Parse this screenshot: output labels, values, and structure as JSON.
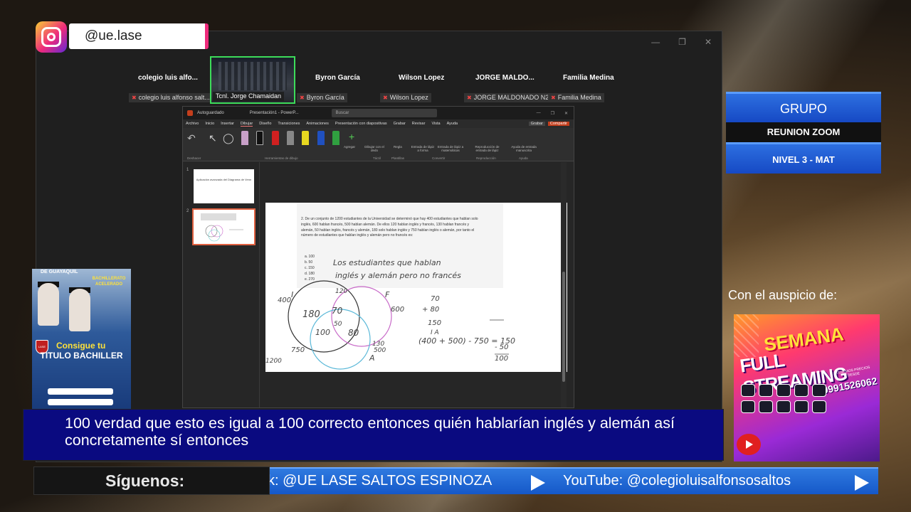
{
  "overlay": {
    "instagram_handle": "@ue.lase",
    "grupo": {
      "row1": "GRUPO",
      "row2": "REUNION ZOOM",
      "row3": "NIVEL 3 - MAT"
    },
    "auspicio": "Con el auspicio de:",
    "siguenos": "Síguenos:",
    "ticker": [
      "k: @UE LASE SALTOS ESPINOZA",
      "YouTube: @colegioluisalfonsosaltos"
    ],
    "caption": "100 verdad que esto es igual a 100 correcto entonces quién hablarían inglés y alemán así concretamente sí entonces"
  },
  "zoom": {
    "participants": [
      {
        "name": "colegio luis alfo...",
        "tag": "colegio luis alfonso salt..."
      },
      {
        "name": "",
        "tag": "Tcnl. Jorge Chamaidan"
      },
      {
        "name": "Byron García",
        "tag": "Byron García"
      },
      {
        "name": "Wilson Lopez",
        "tag": "Wilson Lopez"
      },
      {
        "name": "JORGE MALDO...",
        "tag": "JORGE MALDONADO N2"
      },
      {
        "name": "Familia Medina",
        "tag": "Familia Medina"
      }
    ]
  },
  "powerpoint": {
    "autosave": "Autoguardado",
    "file": "Presentación1 - PowerP...",
    "search_placeholder": "Buscar",
    "menu": [
      "Archivo",
      "Inicio",
      "Insertar",
      "Dibujar",
      "Diseño",
      "Transiciones",
      "Animaciones",
      "Presentación con diapositivas",
      "Grabar",
      "Revisar",
      "Vista",
      "Ayuda"
    ],
    "active_menu": "Dibujar",
    "grabar": "Grabar",
    "share": "Compartir",
    "ribbon_labels": [
      "Agregar",
      "Dibujar con el dedo",
      "Regla",
      "Entrada de lápiz a forma",
      "Entrada de lápiz a matemáticas",
      "Reproducción de entrada de lápiz",
      "Ayuda de entrada manuscrita"
    ],
    "ribbon_groups": [
      "Deshacer",
      "Herramientas de dibujo",
      "Táctil",
      "Plantillas",
      "Convertir",
      "Reproducción",
      "Ayuda"
    ],
    "thumb1_title": "Aplicación avanzada del Diagrama de Venn",
    "slide": {
      "problem": "2. De un conjunto de 1200 estudiantes de la Universidad se determinó que hay 400 estudiantes que hablan solo inglés, 600 hablan francés, 500 hablan alemán. De ellos 120 hablan inglés y francés, 130 hablan francés y alemán, 50 hablan inglés, francés y alemán, 180 solo hablan inglés y 750 hablan inglés o alemán, por tanto el número de estudiantes que hablan inglés y alemán pero no francés es:",
      "options": [
        "a. 100",
        "b. 50",
        "c. 150",
        "d. 180",
        "e. 270"
      ],
      "handwriting1": "Los estudiantes que hablan",
      "handwriting2": "inglés y alemán pero no francés",
      "venn_labels": [
        "I",
        "F",
        "A"
      ],
      "venn_values": [
        "400",
        "120",
        "180",
        "70",
        "600",
        "100",
        "50",
        "80",
        "750",
        "130",
        "500",
        "1200"
      ],
      "calc": [
        "70",
        "+ 80",
        "150",
        "I      A",
        "(400 + 500) - 750 = 150",
        "- 50",
        "100"
      ]
    }
  },
  "promo": {
    "title1": "SEMANA",
    "title2": "FULL STREAMING",
    "price": "TENEMOS PRECIOS DESDE",
    "phone": "0991526062"
  },
  "bachiller": {
    "top": "DE GUAYAQUIL",
    "badge": "BACHILLERATO ACELERADO",
    "headline": "Consigue tu",
    "title": "TITULO BACHILLER",
    "crest": "LASE"
  }
}
